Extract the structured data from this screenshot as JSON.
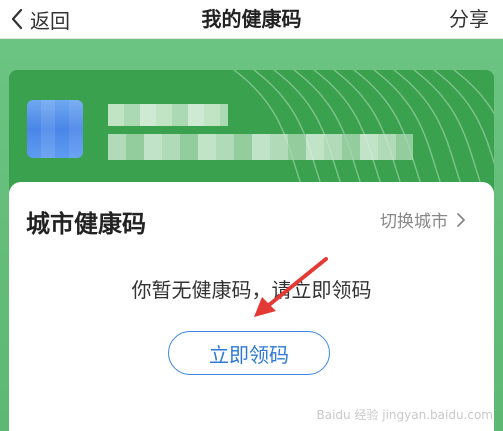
{
  "nav": {
    "back_label": "返回",
    "title": "我的健康码",
    "share_label": "分享"
  },
  "card": {
    "title": "城市健康码",
    "switch_city_label": "切换城市",
    "empty_message": "你暂无健康码，请立即领码",
    "get_code_button": "立即领码"
  },
  "watermark": "Baidu 经验 jingyan.baidu.com",
  "colors": {
    "accent_blue": "#3d86e0",
    "green_background": "#5cb872",
    "card_green": "#3aa24f",
    "annotation_red": "#e53935"
  },
  "icons": [
    "chevron-left-icon",
    "chevron-right-icon",
    "annotation-arrow-icon"
  ]
}
